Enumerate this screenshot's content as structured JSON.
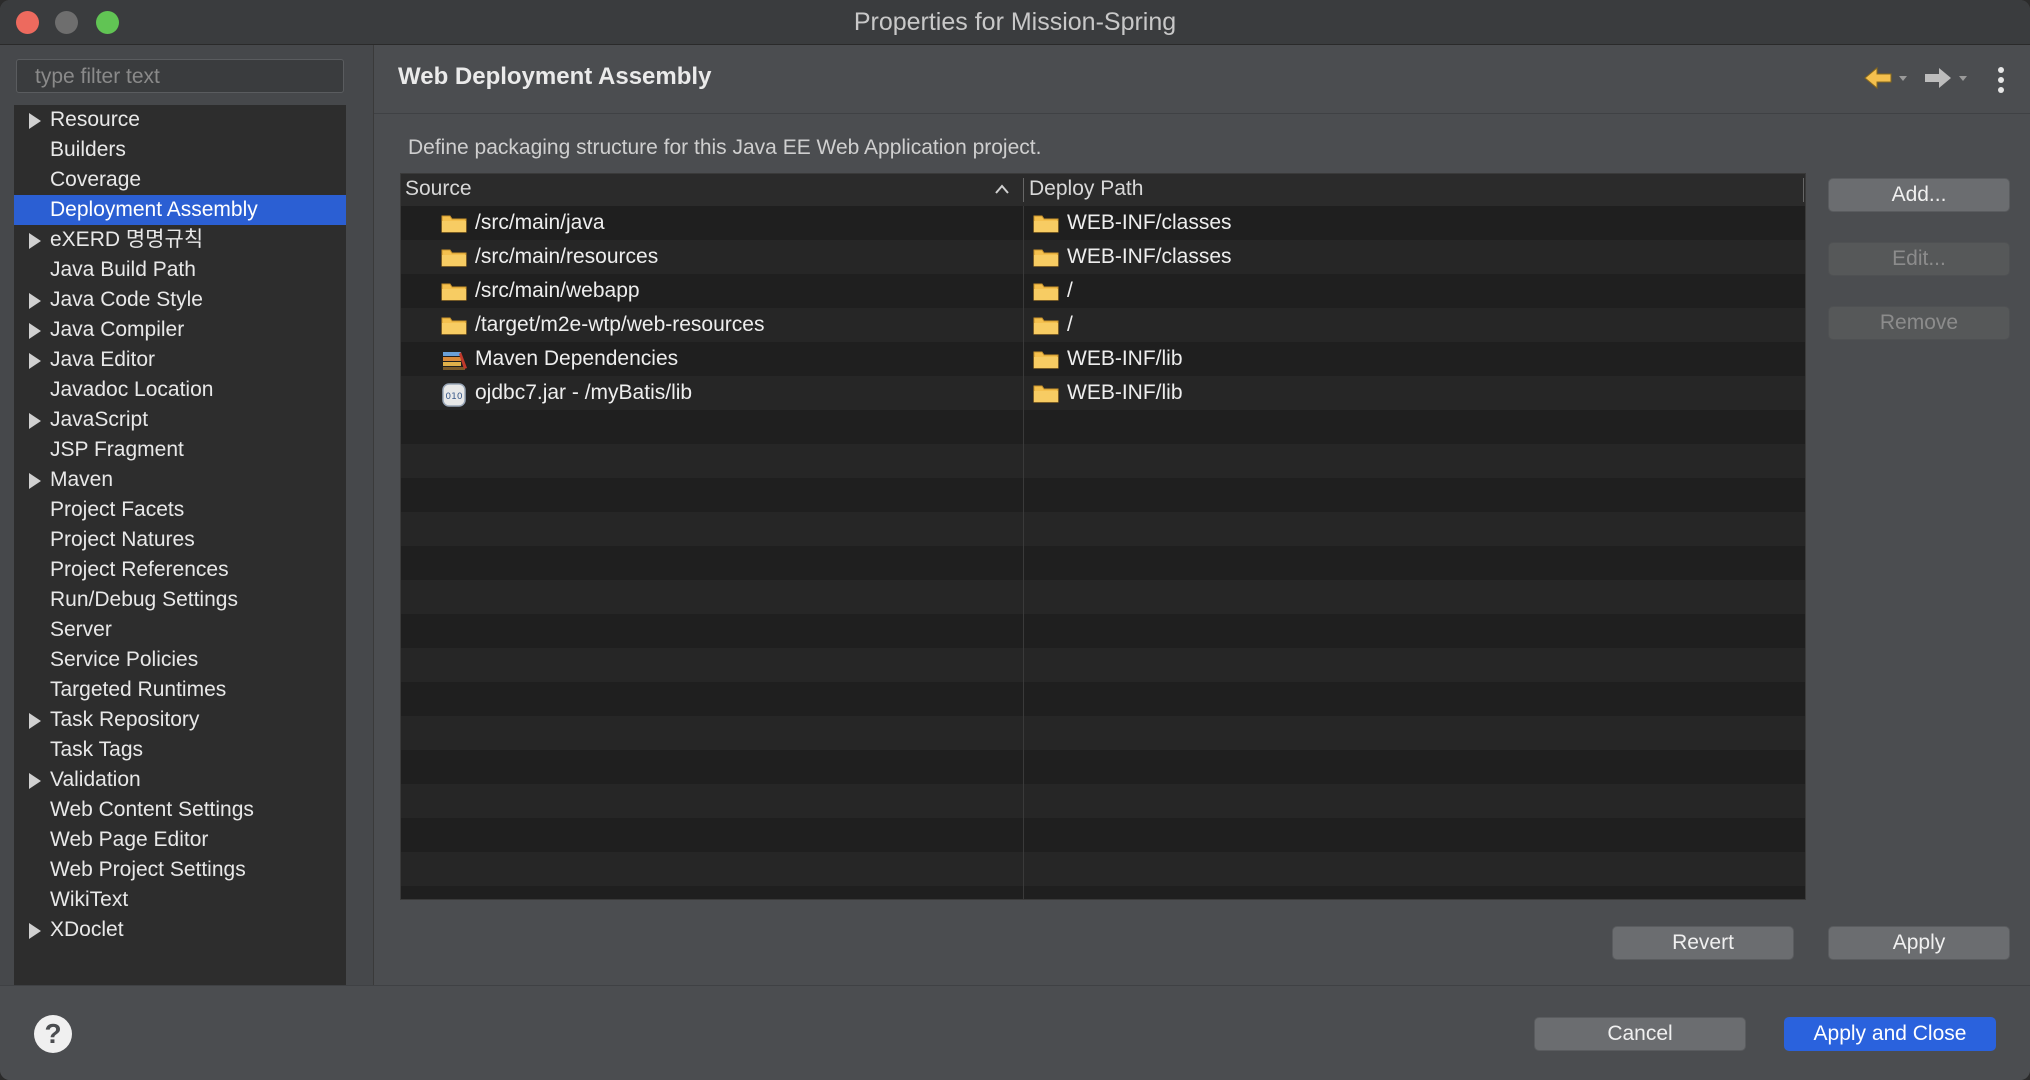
{
  "window": {
    "title": "Properties for Mission-Spring"
  },
  "filter": {
    "placeholder": "type filter text"
  },
  "tree": [
    {
      "label": "Resource",
      "expandable": true,
      "selected": false
    },
    {
      "label": "Builders",
      "expandable": false,
      "selected": false
    },
    {
      "label": "Coverage",
      "expandable": false,
      "selected": false
    },
    {
      "label": "Deployment Assembly",
      "expandable": false,
      "selected": true
    },
    {
      "label": "eXERD 명명규칙",
      "expandable": true,
      "selected": false
    },
    {
      "label": "Java Build Path",
      "expandable": false,
      "selected": false
    },
    {
      "label": "Java Code Style",
      "expandable": true,
      "selected": false
    },
    {
      "label": "Java Compiler",
      "expandable": true,
      "selected": false
    },
    {
      "label": "Java Editor",
      "expandable": true,
      "selected": false
    },
    {
      "label": "Javadoc Location",
      "expandable": false,
      "selected": false
    },
    {
      "label": "JavaScript",
      "expandable": true,
      "selected": false
    },
    {
      "label": "JSP Fragment",
      "expandable": false,
      "selected": false
    },
    {
      "label": "Maven",
      "expandable": true,
      "selected": false
    },
    {
      "label": "Project Facets",
      "expandable": false,
      "selected": false
    },
    {
      "label": "Project Natures",
      "expandable": false,
      "selected": false
    },
    {
      "label": "Project References",
      "expandable": false,
      "selected": false
    },
    {
      "label": "Run/Debug Settings",
      "expandable": false,
      "selected": false
    },
    {
      "label": "Server",
      "expandable": false,
      "selected": false
    },
    {
      "label": "Service Policies",
      "expandable": false,
      "selected": false
    },
    {
      "label": "Targeted Runtimes",
      "expandable": false,
      "selected": false
    },
    {
      "label": "Task Repository",
      "expandable": true,
      "selected": false
    },
    {
      "label": "Task Tags",
      "expandable": false,
      "selected": false
    },
    {
      "label": "Validation",
      "expandable": true,
      "selected": false
    },
    {
      "label": "Web Content Settings",
      "expandable": false,
      "selected": false
    },
    {
      "label": "Web Page Editor",
      "expandable": false,
      "selected": false
    },
    {
      "label": "Web Project Settings",
      "expandable": false,
      "selected": false
    },
    {
      "label": "WikiText",
      "expandable": false,
      "selected": false
    },
    {
      "label": "XDoclet",
      "expandable": true,
      "selected": false
    }
  ],
  "page": {
    "title": "Web Deployment Assembly",
    "description": "Define packaging structure for this Java EE Web Application project."
  },
  "table": {
    "headers": {
      "source": "Source",
      "deploy_path": "Deploy Path"
    },
    "rows": [
      {
        "source": "/src/main/java",
        "source_icon": "folder-icon",
        "deploy": "WEB-INF/classes",
        "deploy_icon": "folder-icon"
      },
      {
        "source": "/src/main/resources",
        "source_icon": "folder-icon",
        "deploy": "WEB-INF/classes",
        "deploy_icon": "folder-icon"
      },
      {
        "source": "/src/main/webapp",
        "source_icon": "folder-icon",
        "deploy": "/",
        "deploy_icon": "folder-icon"
      },
      {
        "source": "/target/m2e-wtp/web-resources",
        "source_icon": "folder-icon",
        "deploy": "/",
        "deploy_icon": "folder-icon"
      },
      {
        "source": "Maven Dependencies",
        "source_icon": "library-icon",
        "deploy": "WEB-INF/lib",
        "deploy_icon": "folder-icon"
      },
      {
        "source": "ojdbc7.jar - /myBatis/lib",
        "source_icon": "jar-icon",
        "deploy": "WEB-INF/lib",
        "deploy_icon": "folder-icon"
      }
    ]
  },
  "side_buttons": {
    "add": "Add...",
    "edit": "Edit...",
    "remove": "Remove"
  },
  "page_buttons": {
    "revert": "Revert",
    "apply": "Apply"
  },
  "footer": {
    "help": "?",
    "cancel": "Cancel",
    "apply_and_close": "Apply and Close"
  },
  "colors": {
    "accent": "#2b5fd3",
    "primary_button": "#2a62dd",
    "folder": "#f4c04e"
  }
}
